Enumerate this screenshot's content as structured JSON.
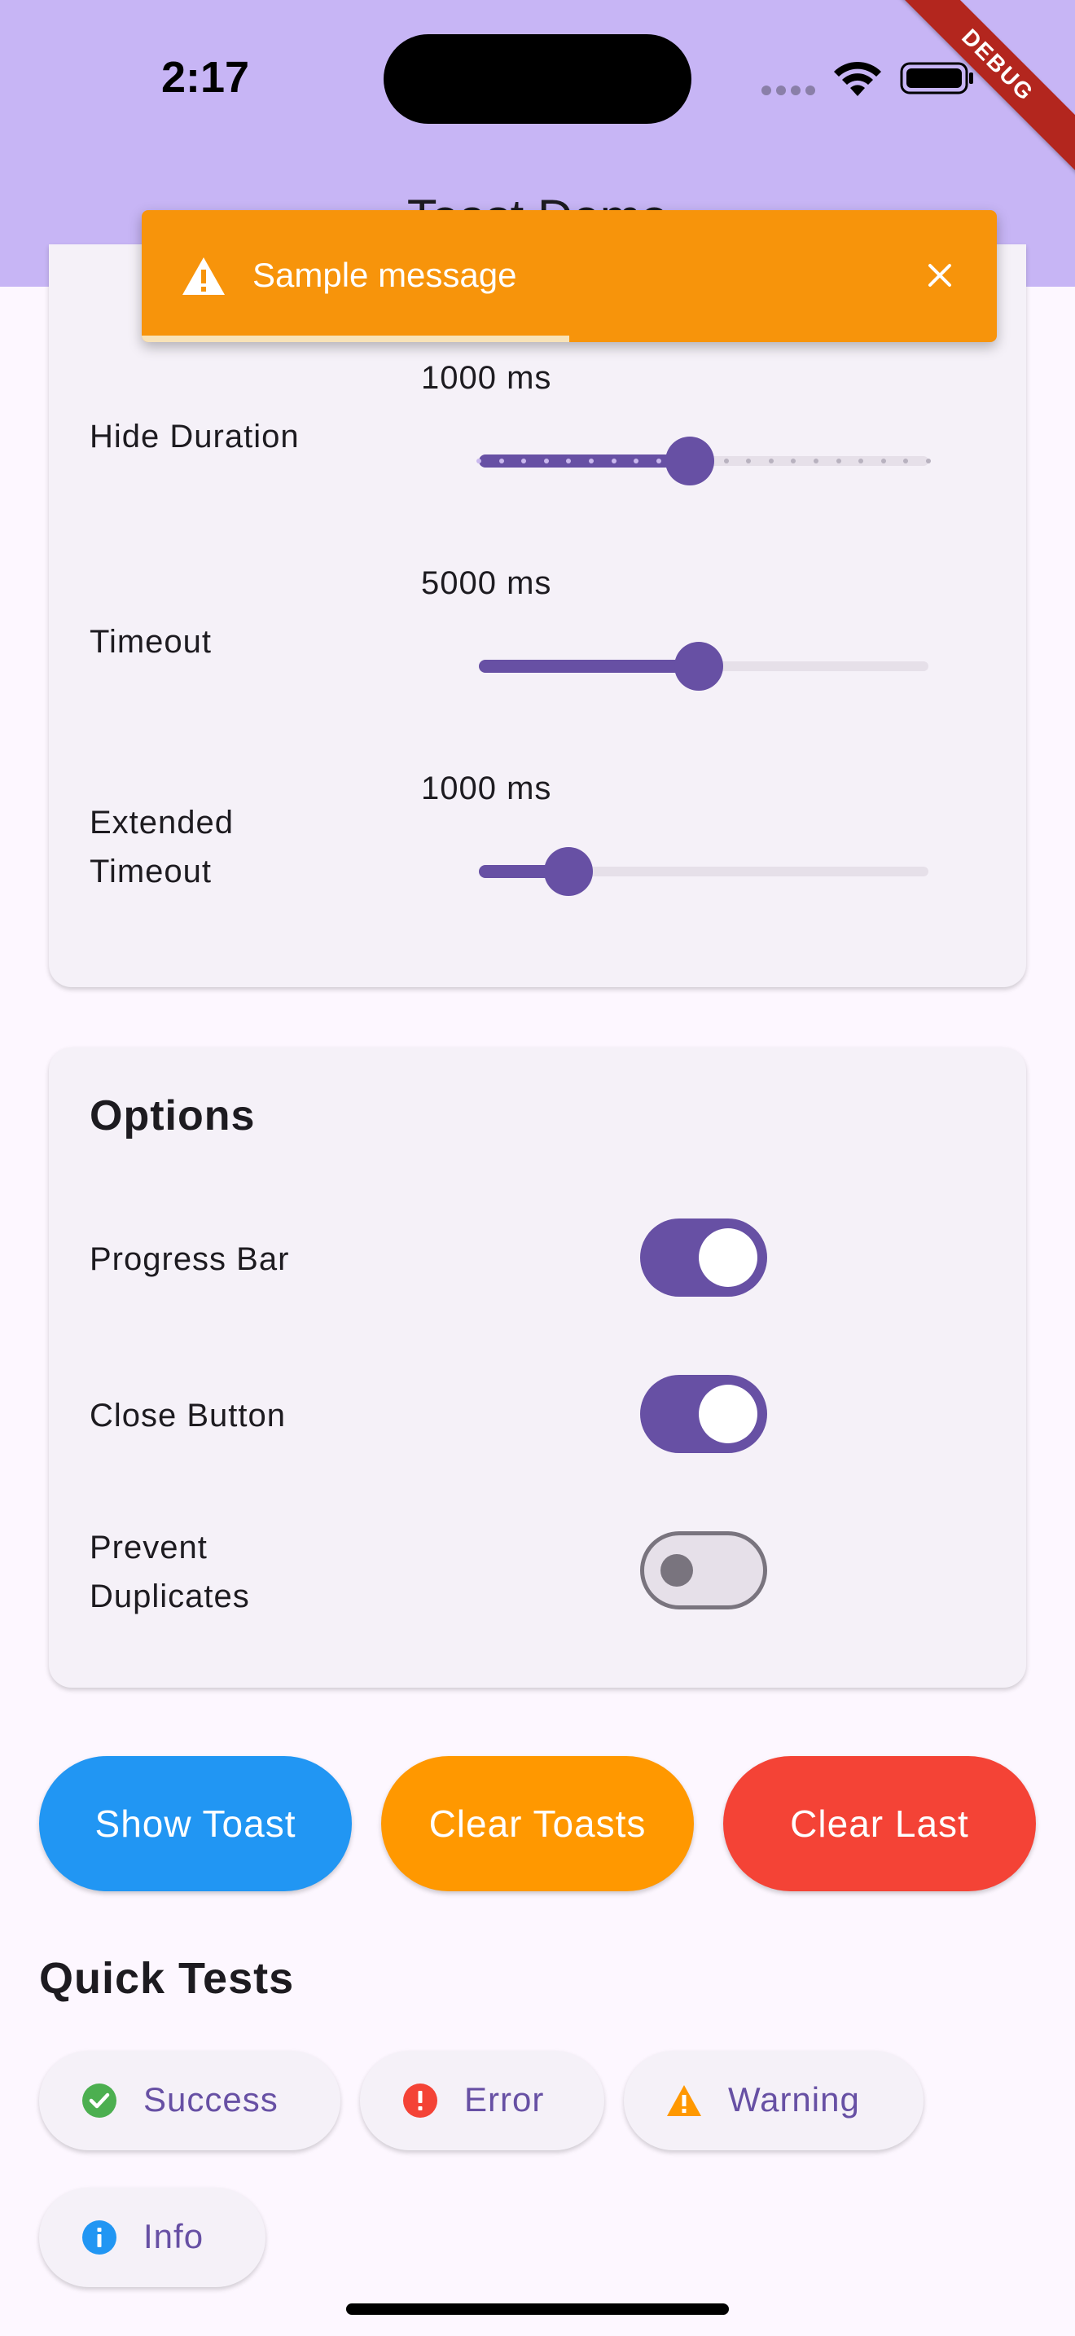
{
  "status_bar": {
    "time": "2:17",
    "debug_label": "DEBUG"
  },
  "app_bar": {
    "title": "Toast Demo"
  },
  "toast": {
    "message": "Sample message",
    "icon": "warning-icon",
    "color": "#f7940b",
    "progress": 0.5
  },
  "timing": {
    "hide_duration": {
      "label": "Hide Duration",
      "value_text": "1000 ms",
      "fraction": 0.47
    },
    "timeout": {
      "label": "Timeout",
      "value_text": "5000 ms",
      "fraction": 0.49
    },
    "extended_timeout": {
      "label": "Extended\nTimeout",
      "value_text": "1000 ms",
      "fraction": 0.2
    }
  },
  "options": {
    "title": "Options",
    "progress_bar": {
      "label": "Progress Bar",
      "on": true
    },
    "close_button": {
      "label": "Close Button",
      "on": true
    },
    "prevent_duplicates": {
      "label": "Prevent\nDuplicates",
      "on": false
    }
  },
  "actions": {
    "show_toast": "Show Toast",
    "clear_toasts": "Clear Toasts",
    "clear_last": "Clear Last"
  },
  "quick_tests": {
    "title": "Quick Tests",
    "success": "Success",
    "error": "Error",
    "warning": "Warning",
    "info": "Info"
  },
  "colors": {
    "primary": "#6750a4",
    "success": "#4caf50",
    "error": "#f44336",
    "warning": "#ff9800",
    "info": "#2196f3"
  }
}
